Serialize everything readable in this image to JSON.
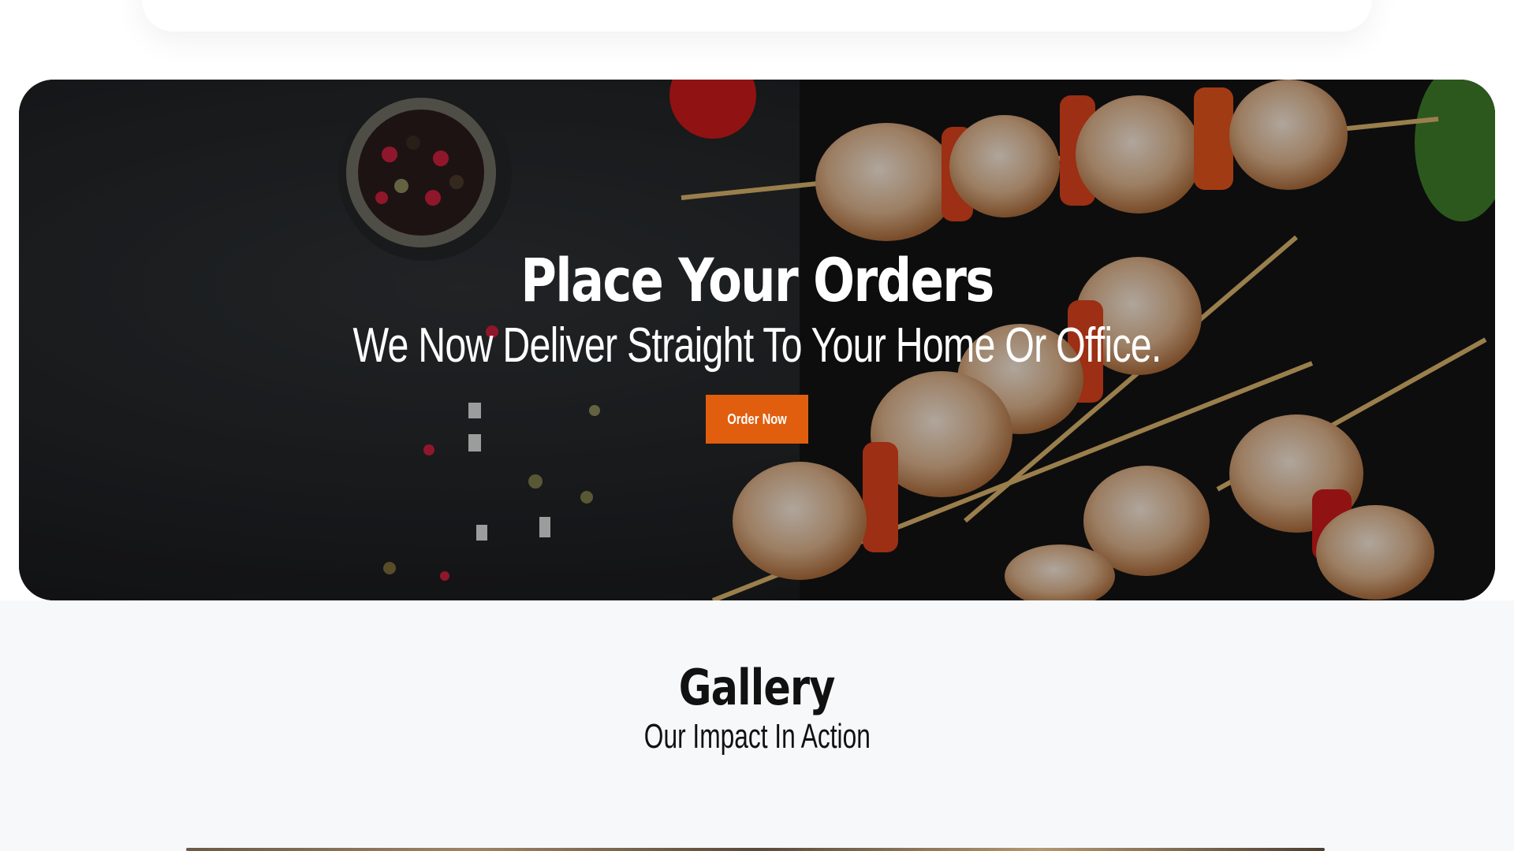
{
  "hero": {
    "title": "Place Your Orders",
    "subtitle": "We Now Deliver Straight To Your Home Or Office.",
    "cta_label": "Order Now",
    "accent_color": "#e05e0e"
  },
  "gallery": {
    "title": "Gallery",
    "subtitle": "Our Impact In Action"
  }
}
